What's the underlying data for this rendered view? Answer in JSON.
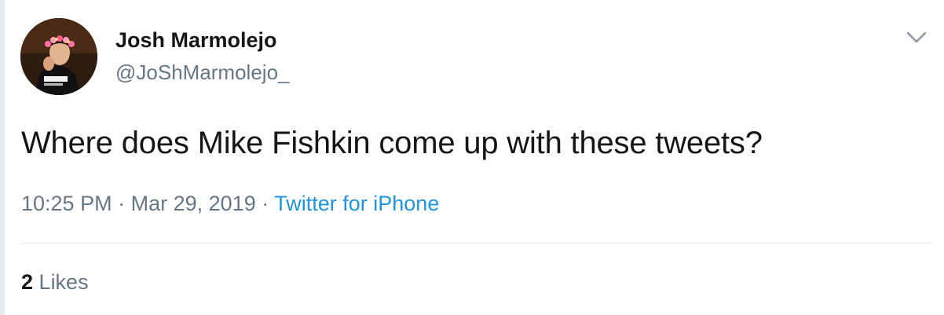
{
  "author": {
    "display_name": "Josh Marmolejo",
    "handle": "@JoShMarmolejo_",
    "avatar_icon": "user-avatar"
  },
  "tweet": {
    "text": "Where does Mike Fishkin come up with these tweets?",
    "time": "10:25 PM",
    "separator": "·",
    "date": "Mar 29, 2019",
    "source": "Twitter for iPhone"
  },
  "stats": {
    "likes_count": "2",
    "likes_label": "Likes"
  },
  "menu": {
    "icon": "chevron-down-icon"
  },
  "colors": {
    "text_primary": "#14171a",
    "text_secondary": "#657786",
    "link": "#1b95e0",
    "border": "#e6ecf0"
  }
}
